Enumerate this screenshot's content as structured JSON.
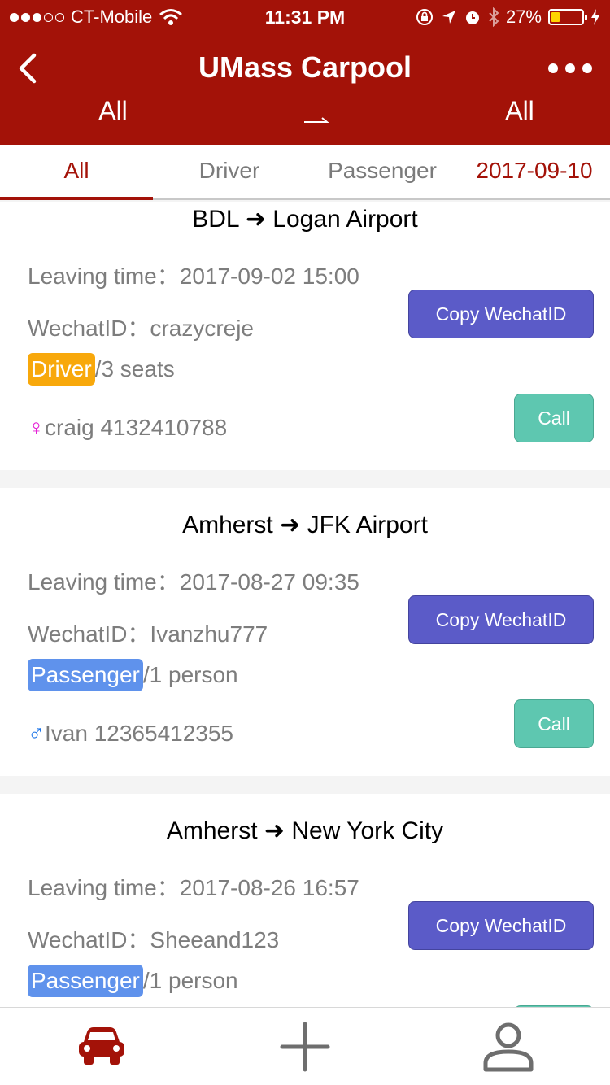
{
  "status_bar": {
    "carrier": "CT-Mobile",
    "time": "11:31 PM",
    "battery": "27%",
    "battery_level": 0.27,
    "icons": [
      "signal-dots",
      "wifi-icon",
      "rotation-lock-icon",
      "location-arrow-icon",
      "alarm-icon",
      "bluetooth-icon",
      "battery-icon",
      "charging-bolt-icon"
    ]
  },
  "nav": {
    "title": "UMass Carpool",
    "back_icon": "chevron-left-icon",
    "more_icon": "more-dots-icon"
  },
  "route_filter": {
    "from": "All",
    "to": "All"
  },
  "tabs": [
    {
      "label": "All",
      "active": true
    },
    {
      "label": "Driver",
      "active": false
    },
    {
      "label": "Passenger",
      "active": false
    },
    {
      "label": "2017-09-10",
      "active": false
    }
  ],
  "rides": [
    {
      "route": "BDL ➜ Logan Airport",
      "leaving_label": "Leaving time：",
      "leaving_time": "2017-09-02 15:00",
      "wechat_label": "WechatID：",
      "wechat_id": "crazycreje",
      "role": "Driver",
      "capacity": "/3 seats",
      "gender_symbol": "♀",
      "contact": "craig 4132410788",
      "copy_label": "Copy WechatID",
      "call_label": "Call"
    },
    {
      "route": "Amherst ➜ JFK Airport",
      "leaving_label": "Leaving time：",
      "leaving_time": "2017-08-27 09:35",
      "wechat_label": "WechatID：",
      "wechat_id": "Ivanzhu777",
      "role": "Passenger",
      "capacity": "/1 person",
      "gender_symbol": "♂",
      "contact": "Ivan 12365412355",
      "copy_label": "Copy WechatID",
      "call_label": "Call"
    },
    {
      "route": "Amherst ➜ New York City",
      "leaving_label": "Leaving time：",
      "leaving_time": "2017-08-26 16:57",
      "wechat_label": "WechatID：",
      "wechat_id": "Sheeand123",
      "role": "Passenger",
      "capacity": "/1 person",
      "copy_label": "Copy WechatID"
    }
  ],
  "bottom_nav": [
    {
      "icon": "car-icon",
      "active": true
    },
    {
      "icon": "plus-icon",
      "active": false
    },
    {
      "icon": "person-icon",
      "active": false
    }
  ],
  "colors": {
    "brand_red": "#a31208",
    "driver_badge": "#f8a80b",
    "passenger_badge": "#5f92ec",
    "copy_button": "#5b5bc8",
    "call_button": "#5ec7b0",
    "female": "#e41fd6",
    "male": "#1a73e8"
  }
}
